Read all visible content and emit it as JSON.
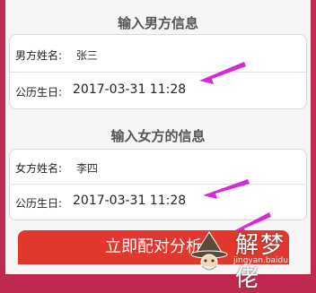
{
  "male": {
    "section_title": "输入男方信息",
    "name_label": "男方姓名:",
    "name_value": "张三",
    "birth_label": "公历生日:",
    "birth_value": "2017-03-31 11:28"
  },
  "female": {
    "section_title": "输入女方的信息",
    "name_label": "女方姓名:",
    "name_value": "李四",
    "birth_label": "公历生日:",
    "birth_value": "2017-03-31 11:28"
  },
  "action": {
    "analyze_label": "立即配对分析"
  },
  "watermark": {
    "text": "解梦佬",
    "url": "jingyan.baidu.com"
  },
  "colors": {
    "frame": "#c0294f",
    "button": "#e2372c",
    "arrow": "#d62ad6"
  },
  "icons": {
    "arrow": "magenta-pointer-arrow-icon"
  }
}
